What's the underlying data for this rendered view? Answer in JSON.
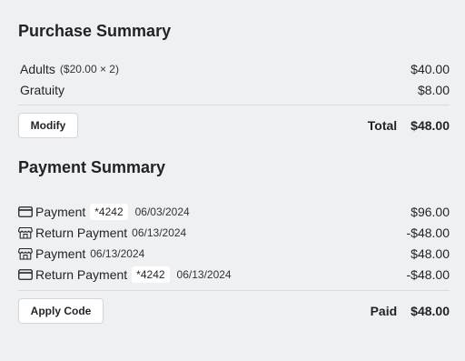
{
  "purchase": {
    "title": "Purchase Summary",
    "items": [
      {
        "label": "Adults",
        "detail": "($20.00 × 2)",
        "amount": "$40.00"
      },
      {
        "label": "Gratuity",
        "detail": "",
        "amount": "$8.00"
      }
    ],
    "modify_label": "Modify",
    "total_label": "Total",
    "total_value": "$48.00"
  },
  "payment": {
    "title": "Payment Summary",
    "rows": [
      {
        "icon": "credit-card-icon",
        "label": "Payment",
        "card": "*4242",
        "date": "06/03/2024",
        "amount": "$96.00"
      },
      {
        "icon": "store-icon",
        "label": "Return Payment",
        "card": "",
        "date": "06/13/2024",
        "amount": "-$48.00"
      },
      {
        "icon": "store-icon",
        "label": "Payment",
        "card": "",
        "date": "06/13/2024",
        "amount": "$48.00"
      },
      {
        "icon": "credit-card-icon",
        "label": "Return Payment",
        "card": "*4242",
        "date": "06/13/2024",
        "amount": "-$48.00"
      }
    ],
    "apply_code_label": "Apply Code",
    "paid_label": "Paid",
    "paid_value": "$48.00"
  }
}
